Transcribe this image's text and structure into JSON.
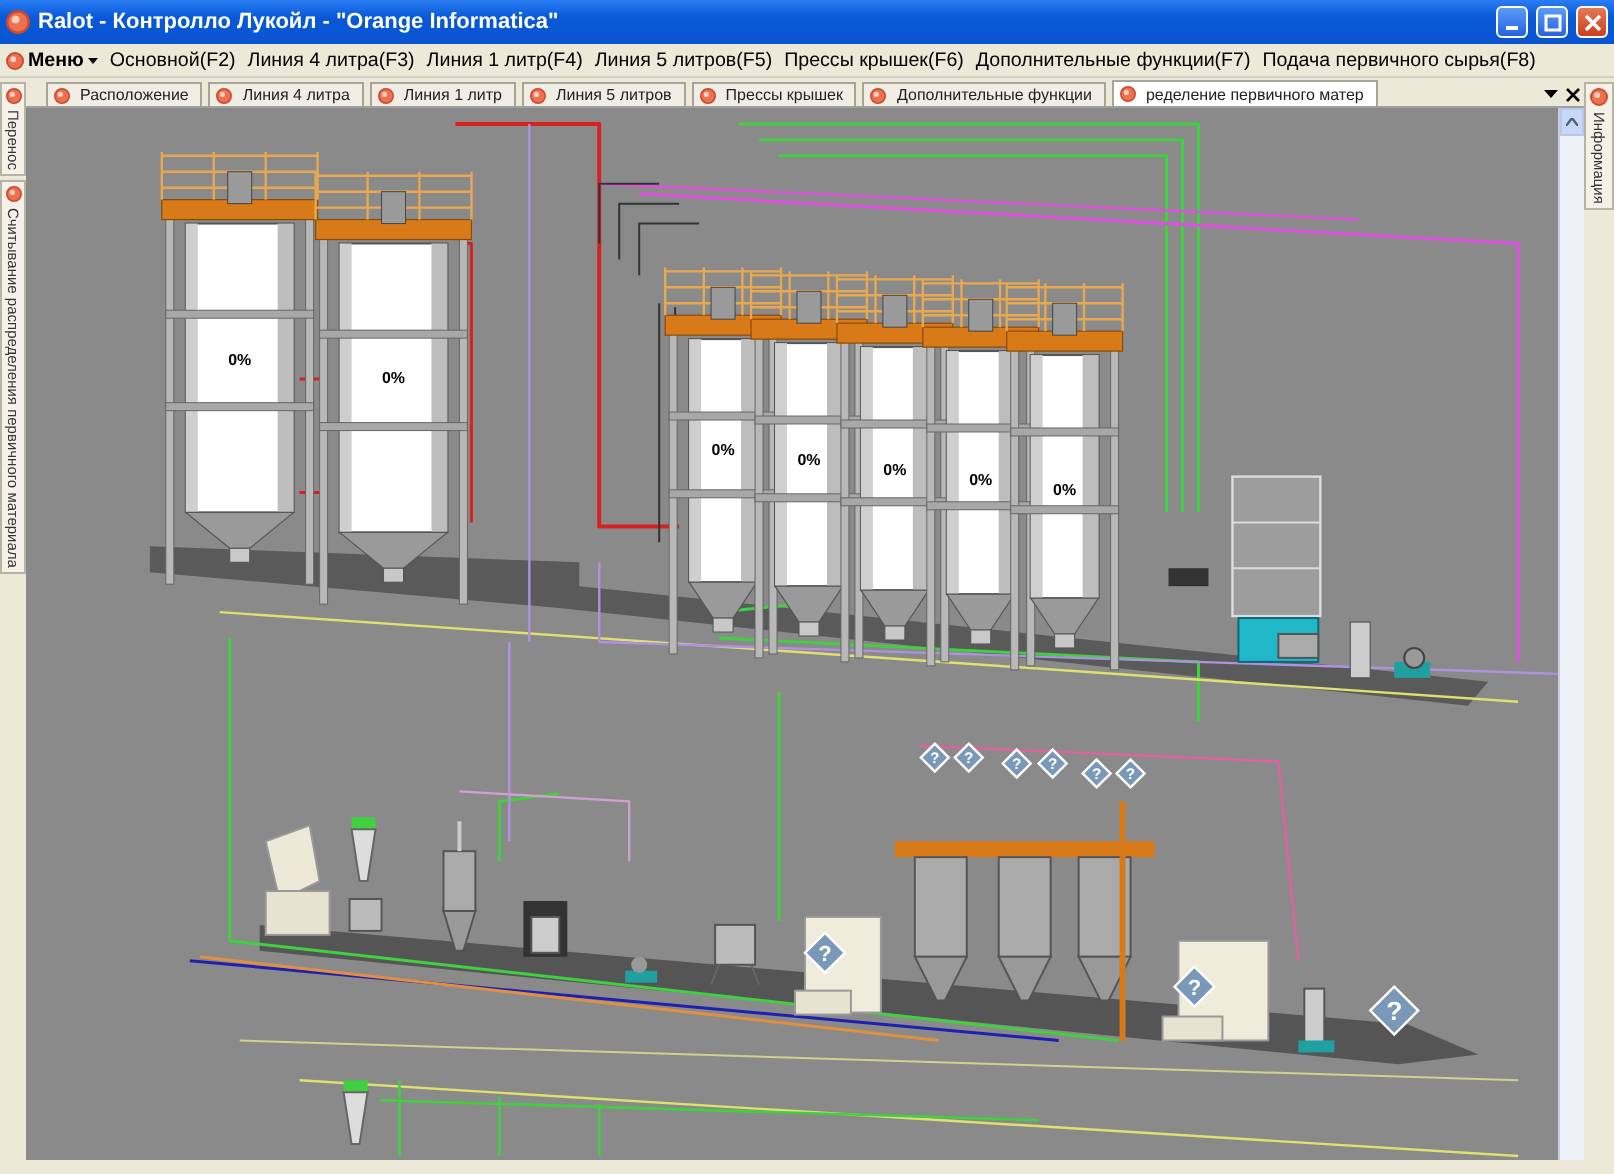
{
  "window": {
    "title": "Ralot - Контролло Лукойл - \"Orange Informatica\""
  },
  "menu": {
    "items": [
      {
        "label": "Меню",
        "kind": "dropdown"
      },
      {
        "label": "Основной(F2)",
        "kind": "plain"
      },
      {
        "label": "Линия 4 литра(F3)",
        "kind": "plain"
      },
      {
        "label": "Линия 1 литр(F4)",
        "kind": "plain"
      },
      {
        "label": "Линия 5 литров(F5)",
        "kind": "plain"
      },
      {
        "label": "Прессы крышек(F6)",
        "kind": "plain"
      },
      {
        "label": "Дополнительные функции(F7)",
        "kind": "plain"
      },
      {
        "label": "Подача первичного сырья(F8)",
        "kind": "plain"
      }
    ]
  },
  "left_panel": {
    "tabs": [
      {
        "label": "Перенос"
      },
      {
        "label": "Считывание распределения первичного материала"
      }
    ]
  },
  "tabs": [
    {
      "label": "Расположение",
      "selected": false
    },
    {
      "label": "Линия 4 литра",
      "selected": false
    },
    {
      "label": "Линия 1 литр",
      "selected": false
    },
    {
      "label": "Линия 5 литров",
      "selected": false
    },
    {
      "label": "Прессы крышек",
      "selected": false
    },
    {
      "label": "Дополнительные функции",
      "selected": false
    },
    {
      "label": "ределение первичного матер",
      "selected": true
    }
  ],
  "right_panel": {
    "tabs": [
      {
        "label": "Информация"
      }
    ]
  },
  "plant": {
    "silos": [
      {
        "reading": "0%"
      },
      {
        "reading": "0%"
      },
      {
        "reading": "0%"
      },
      {
        "reading": "0%"
      },
      {
        "reading": "0%"
      },
      {
        "reading": "0%"
      },
      {
        "reading": "0%"
      }
    ],
    "markers": [
      {
        "symbol": "?"
      },
      {
        "symbol": "?"
      },
      {
        "symbol": "?"
      },
      {
        "symbol": "?"
      },
      {
        "symbol": "?"
      },
      {
        "symbol": "?"
      },
      {
        "symbol": "?"
      },
      {
        "symbol": "?"
      },
      {
        "symbol": "?"
      }
    ]
  }
}
